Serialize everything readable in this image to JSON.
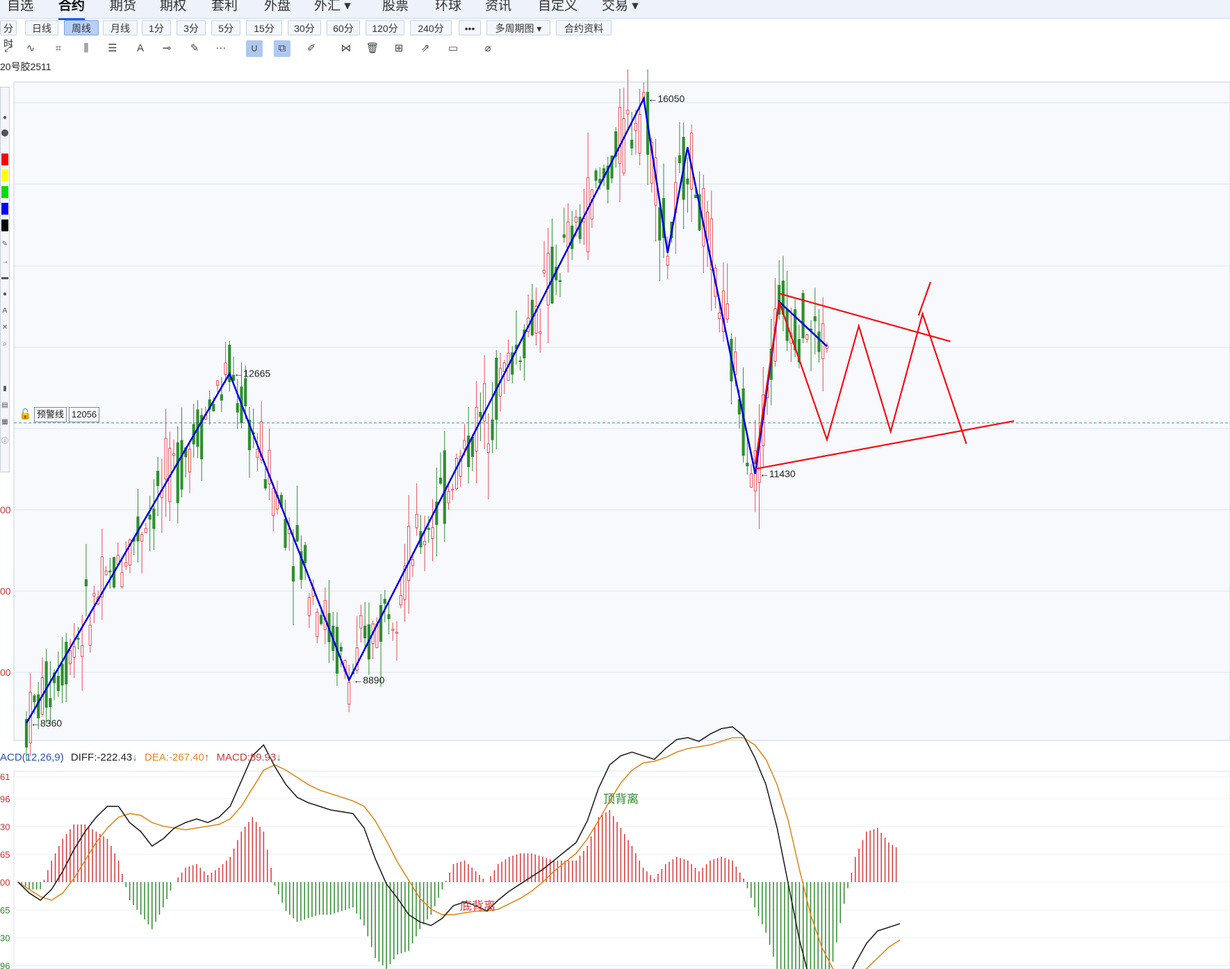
{
  "nav": {
    "items": [
      "自选",
      "合约",
      "期货",
      "期权",
      "套利",
      "外盘",
      "外汇",
      "股票",
      "环球",
      "资讯",
      "自定义",
      "交易"
    ],
    "active": "合约"
  },
  "periods": {
    "items": [
      "分时",
      "日线",
      "周线",
      "月线",
      "1分",
      "3分",
      "5分",
      "15分",
      "30分",
      "60分",
      "120分",
      "240分",
      "•••",
      "多周期图",
      "合约资料"
    ],
    "active": "周线"
  },
  "contract_label": "20号胶2511",
  "alert": {
    "label": "预警线",
    "price": "12056"
  },
  "left_tools": {
    "swatches": [
      "#ff0000",
      "#ffff00",
      "#00dd00",
      "#0000ff",
      "#000000"
    ]
  },
  "macd": {
    "name": "ACD(12,26,9)",
    "diff": "DIFF:-222.43",
    "dea": "DEA:-267.40",
    "macd": "MACD:89.93",
    "y_ticks": [
      "61",
      "96",
      "30",
      "65",
      "00",
      "65",
      "30",
      "96"
    ],
    "colors": {
      "diff": "#222222",
      "dea": "#e08a1e",
      "pos": "#d23a3a",
      "neg": "#2e8b2e"
    },
    "annotations": [
      "顶背离",
      "底背离"
    ]
  },
  "chart_data": [
    {
      "type": "candlestick",
      "title": "",
      "y_tick_labels": [
        "00",
        "00",
        "00"
      ],
      "ylim": [
        8000,
        16500
      ],
      "alert_line": 12056,
      "pivot_labels": [
        "8360",
        "12665",
        "8890",
        "16050",
        "11430"
      ],
      "pivots": [
        {
          "week": 0,
          "price": 8360
        },
        {
          "week": 51,
          "price": 12665
        },
        {
          "week": 81,
          "price": 8890
        },
        {
          "week": 155,
          "price": 16050
        },
        {
          "week": 161,
          "price": 14150
        },
        {
          "week": 166,
          "price": 15450
        },
        {
          "week": 183,
          "price": 11430
        },
        {
          "week": 189,
          "price": 13550
        },
        {
          "week": 201,
          "price": 13000
        }
      ],
      "projection": {
        "zigzag": [
          {
            "week": 183,
            "price": 11550
          },
          {
            "week": 189,
            "price": 13550
          },
          {
            "week": 201,
            "price": 11850
          },
          {
            "week": 209,
            "price": 13250
          },
          {
            "week": 217,
            "price": 11950
          },
          {
            "week": 225,
            "price": 13400
          },
          {
            "week": 236,
            "price": 11800
          }
        ],
        "upper_line": [
          {
            "week": 189,
            "price": 13650
          },
          {
            "week": 232,
            "price": 13060
          }
        ],
        "lower_line": [
          {
            "week": 183,
            "price": 11490
          },
          {
            "week": 248,
            "price": 12080
          }
        ],
        "extra_up": [
          {
            "week": 224,
            "price": 13380
          },
          {
            "week": 227,
            "price": 13790
          }
        ]
      },
      "colors": {
        "up": "#e0505a",
        "down": "#2f8f2f",
        "wave": "#0000dd",
        "projection": "#ee1111"
      }
    },
    {
      "type": "macd",
      "series": [
        {
          "name": "DIFF",
          "values": [
            0,
            -60,
            -100,
            -40,
            60,
            180,
            280,
            360,
            420,
            420,
            330,
            280,
            200,
            240,
            300,
            330,
            350,
            330,
            360,
            420,
            560,
            700,
            760,
            640,
            540,
            470,
            440,
            420,
            400,
            390,
            380,
            300,
            130,
            -10,
            -90,
            -180,
            -220,
            -240,
            -200,
            -130,
            -110,
            -130,
            -160,
            -100,
            -50,
            -10,
            30,
            70,
            120,
            170,
            220,
            340,
            520,
            650,
            700,
            720,
            700,
            680,
            740,
            790,
            800,
            780,
            820,
            850,
            860,
            810,
            690,
            540,
            300,
            -10,
            -320,
            -560,
            -680,
            -700,
            -580,
            -450,
            -340,
            -270,
            -250,
            -230
          ]
        },
        {
          "name": "DEA",
          "values": [
            0,
            -40,
            -80,
            -100,
            -60,
            20,
            120,
            220,
            300,
            360,
            380,
            370,
            330,
            310,
            300,
            290,
            300,
            310,
            320,
            350,
            420,
            520,
            620,
            650,
            620,
            580,
            540,
            510,
            490,
            470,
            450,
            420,
            340,
            230,
            110,
            10,
            -90,
            -150,
            -180,
            -180,
            -170,
            -160,
            -160,
            -150,
            -120,
            -90,
            -50,
            0,
            60,
            110,
            160,
            240,
            340,
            450,
            550,
            620,
            660,
            670,
            690,
            720,
            740,
            750,
            760,
            780,
            800,
            800,
            760,
            680,
            540,
            340,
            70,
            -180,
            -360,
            -480,
            -520,
            -520,
            -480,
            -420,
            -360,
            -320
          ]
        },
        {
          "name": "MACD",
          "values": [
            0,
            -40,
            -40,
            120,
            240,
            320,
            320,
            280,
            240,
            120,
            -100,
            -180,
            -260,
            -140,
            0,
            80,
            100,
            40,
            80,
            140,
            280,
            360,
            280,
            -20,
            -160,
            -220,
            -200,
            -180,
            -180,
            -160,
            -140,
            -240,
            -420,
            -480,
            -400,
            -380,
            -260,
            -180,
            -40,
            100,
            120,
            60,
            0,
            100,
            140,
            160,
            160,
            140,
            120,
            120,
            120,
            200,
            360,
            400,
            300,
            200,
            80,
            20,
            100,
            140,
            120,
            60,
            120,
            140,
            120,
            20,
            -140,
            -280,
            -480,
            -700,
            -780,
            -760,
            -640,
            -440,
            -120,
            140,
            280,
            300,
            220,
            180
          ]
        }
      ]
    }
  ]
}
